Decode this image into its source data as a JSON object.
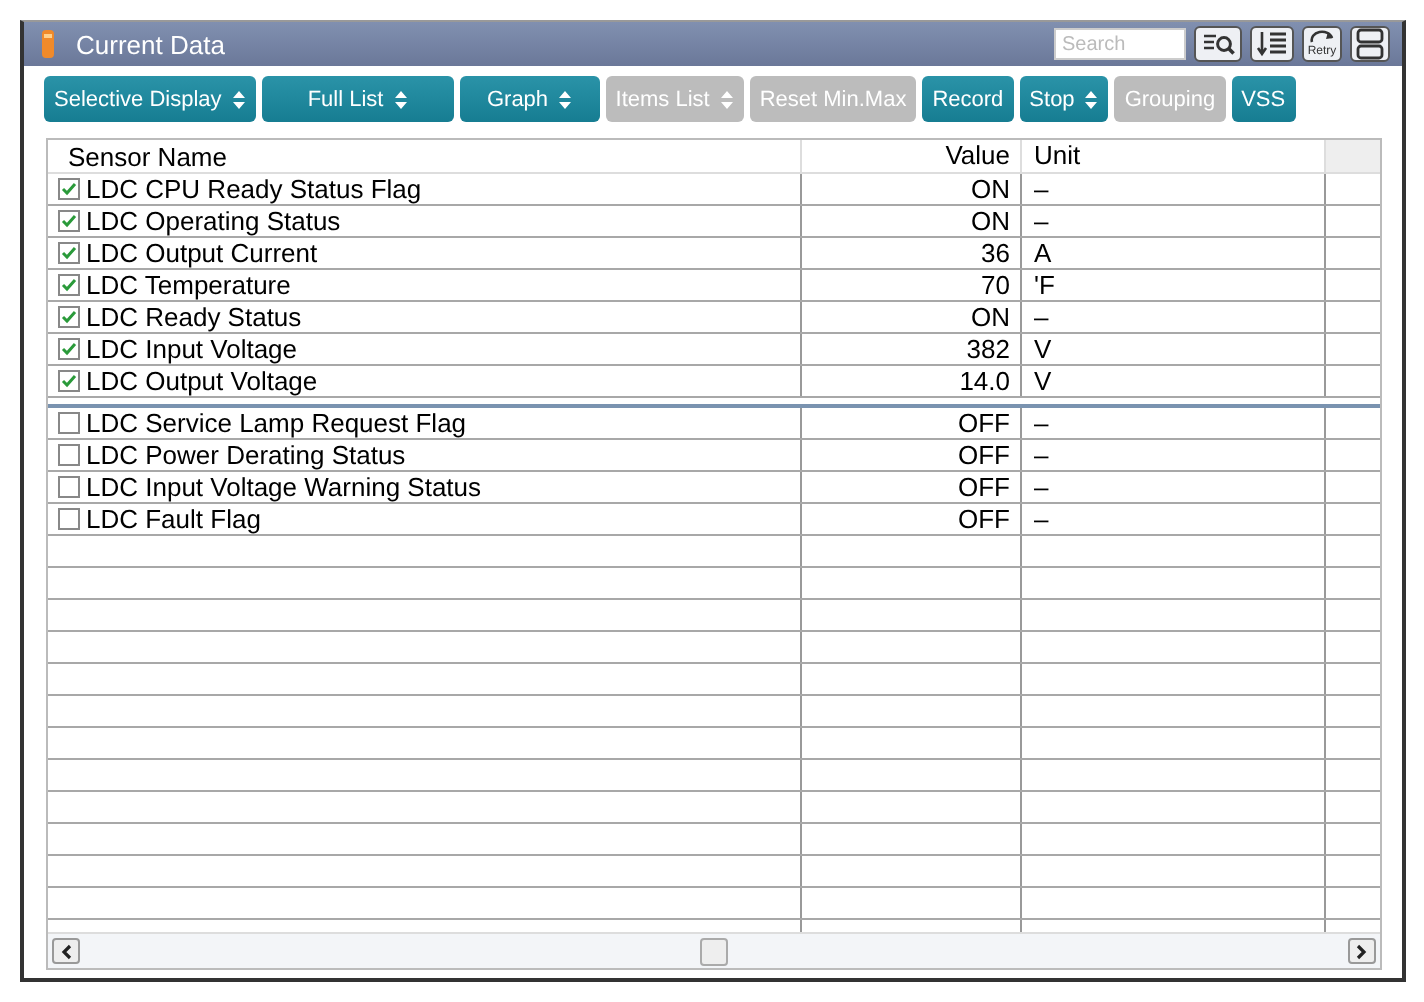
{
  "window": {
    "title": "Current Data"
  },
  "title_bar": {
    "search": {
      "placeholder": "Search"
    },
    "retry_label": "Retry"
  },
  "toolbar": [
    {
      "label": "Selective Display",
      "kind": "dropdown",
      "disabled": false
    },
    {
      "label": "Full List",
      "kind": "dropdown",
      "disabled": false
    },
    {
      "label": "Graph",
      "kind": "dropdown",
      "disabled": false
    },
    {
      "label": "Items List",
      "kind": "dropdown",
      "disabled": true
    },
    {
      "label": "Reset Min.Max",
      "kind": "button",
      "disabled": true
    },
    {
      "label": "Record",
      "kind": "button",
      "disabled": false
    },
    {
      "label": "Stop",
      "kind": "dropdown",
      "disabled": false
    },
    {
      "label": "Grouping",
      "kind": "button",
      "disabled": true
    },
    {
      "label": "VSS",
      "kind": "button",
      "disabled": false
    }
  ],
  "table": {
    "columns": [
      "Sensor Name",
      "Value",
      "Unit"
    ],
    "groups": [
      {
        "rows": [
          {
            "checked": true,
            "name": "LDC CPU Ready Status Flag",
            "value": "ON",
            "unit": "–"
          },
          {
            "checked": true,
            "name": "LDC Operating Status",
            "value": "ON",
            "unit": "–"
          },
          {
            "checked": true,
            "name": "LDC Output Current",
            "value": "36",
            "unit": "A"
          },
          {
            "checked": true,
            "name": "LDC Temperature",
            "value": "70",
            "unit": "'F"
          },
          {
            "checked": true,
            "name": "LDC Ready Status",
            "value": "ON",
            "unit": "–"
          },
          {
            "checked": true,
            "name": "LDC Input Voltage",
            "value": "382",
            "unit": "V"
          },
          {
            "checked": true,
            "name": "LDC Output Voltage",
            "value": "14.0",
            "unit": "V"
          }
        ]
      },
      {
        "rows": [
          {
            "checked": false,
            "name": "LDC Service Lamp Request Flag",
            "value": "OFF",
            "unit": "–"
          },
          {
            "checked": false,
            "name": "LDC Power Derating Status",
            "value": "OFF",
            "unit": "–"
          },
          {
            "checked": false,
            "name": "LDC Input Voltage Warning Status",
            "value": "OFF",
            "unit": "–"
          },
          {
            "checked": false,
            "name": "LDC Fault Flag",
            "value": "OFF",
            "unit": "–"
          }
        ]
      }
    ]
  }
}
